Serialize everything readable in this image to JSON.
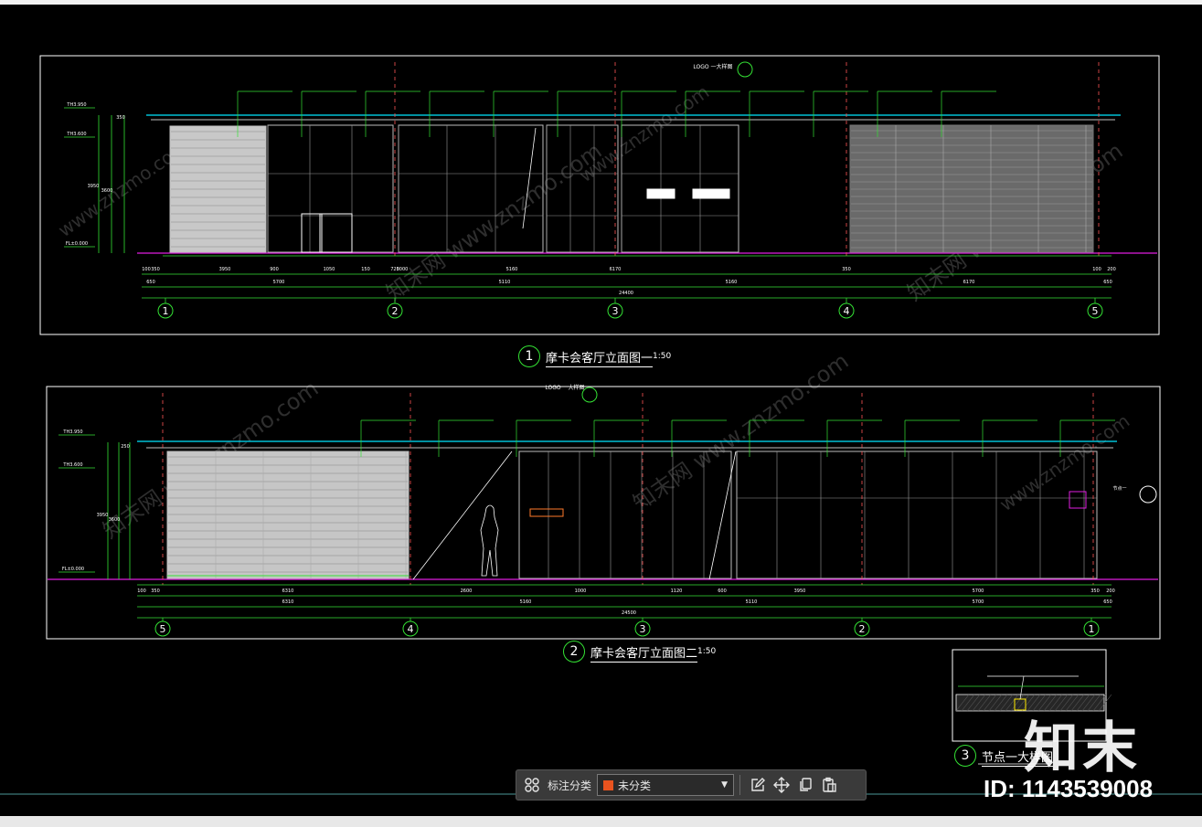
{
  "drawing": {
    "elevation1_title": "摩卡会客厅立面图一",
    "elevation1_scale": "1:50",
    "elevation1_number": "1",
    "elevation2_title": "摩卡会客厅立面图二",
    "elevation2_scale": "1:50",
    "elevation2_number": "2",
    "detail_title": "节点一大样图",
    "detail_number": "3",
    "grid1": [
      "1",
      "2",
      "3",
      "4",
      "5"
    ],
    "grid2": [
      "5",
      "4",
      "3",
      "2",
      "1"
    ],
    "dims1_top": [
      "100",
      "350",
      "3950",
      "900",
      "1050",
      "150",
      "720",
      "5000",
      "5160",
      "6170",
      "350",
      "100",
      "200"
    ],
    "dims1_mid": [
      "650",
      "5700",
      "5110",
      "5160",
      "6170",
      "650"
    ],
    "dims1_total": "24400",
    "dims2_top": [
      "100",
      "350",
      "6310",
      "2600",
      "1000",
      "1120",
      "600",
      "3950",
      "5700",
      "350",
      "200"
    ],
    "dims2_mid": [
      "6310",
      "5160",
      "5110",
      "5700",
      "650"
    ],
    "dims2_total": "24500",
    "levels1": [
      "TH3.950",
      "TH3.600",
      "FL±0.000"
    ],
    "levels2": [
      "TH3.950",
      "TH3.600",
      "FL±0.000"
    ],
    "vdims": [
      "3950",
      "3600",
      "350",
      "250"
    ],
    "logo_label": "LOGO 一大样图",
    "node_label": "节点一"
  },
  "watermark": {
    "text_cn": "知末网",
    "text_url": "www.znzmo.com"
  },
  "brand": {
    "logo_text": "知末",
    "id_label": "ID: 1143539008"
  },
  "toolbar": {
    "grid_icon": "grid-icon",
    "category_label": "标注分类",
    "category_value": "未分类",
    "category_color": "#e8531f",
    "edit_icon": "edit-icon",
    "move_icon": "move-icon",
    "copy_icon": "copy-icon",
    "paste_icon": "paste-icon"
  },
  "colors": {
    "background": "#000000",
    "frame": "#ffffff",
    "green": "#34e234",
    "cyan": "#00e5ff",
    "magenta": "#e01ee0",
    "red": "#ff3333",
    "yellow": "#ffe800"
  }
}
